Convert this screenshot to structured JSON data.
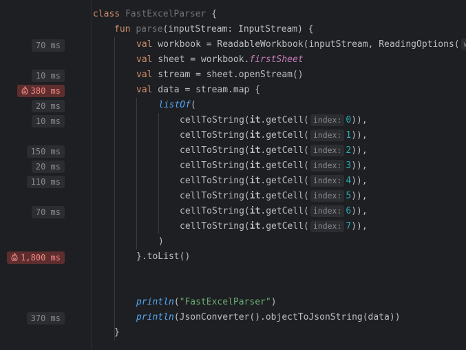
{
  "gutter": {
    "badges": [
      {
        "label": "70 ms",
        "hot": false
      },
      {
        "label": "10 ms",
        "hot": false
      },
      {
        "label": "380 ms",
        "hot": true
      },
      {
        "label": "20 ms",
        "hot": false
      },
      {
        "label": "10 ms",
        "hot": false
      },
      {
        "label": "150 ms",
        "hot": false
      },
      {
        "label": "20 ms",
        "hot": false
      },
      {
        "label": "110 ms",
        "hot": false
      },
      {
        "label": "70 ms",
        "hot": false
      },
      {
        "label": "1,800 ms",
        "hot": true
      },
      {
        "label": "370 ms",
        "hot": false
      }
    ]
  },
  "code": {
    "class_kw": "class",
    "class_name": "FastExcelParser",
    "brace_open": " {",
    "fun_kw": "fun",
    "fun_name": "parse",
    "fun_sig": "(inputStream: InputStream) {",
    "val_kw": "val",
    "l3_rest": " workbook = ReadableWorkbook(inputStream, ReadingOptions(",
    "l3_hint": "w",
    "l4_rest": " sheet = workbook.",
    "l4_prop": "firstSheet",
    "l5_rest": " stream = sheet.openStream()",
    "l6_rest": " data = stream.map {",
    "listof": "listOf",
    "paren_open": "(",
    "call_prefix": "cellToString(",
    "it_kw": "it",
    "get_cell": ".getCell(",
    "hint_index": "index:",
    "cell_indices": [
      "0",
      "1",
      "2",
      "3",
      "4",
      "5",
      "6",
      "7"
    ],
    "call_suffix": ")),",
    "paren_close": ")",
    "tolist": "}.toList()",
    "println": "println",
    "print1_arg_open": "(",
    "print1_str": "\"FastExcelParser\"",
    "print1_close": ")",
    "print2_rest": "(JsonConverter().objectToJsonString(data))",
    "brace_close": "}"
  },
  "colors": {
    "background": "#1e1f22",
    "keyword": "#cf8e6d",
    "function": "#56a8f5",
    "number": "#2aacb8",
    "string": "#6aab73",
    "property": "#c77dbb",
    "hot_badge_bg": "#5e2e2f",
    "hot_badge_text": "#ef8782"
  },
  "icons": {
    "hot_badge": "flame-icon"
  }
}
